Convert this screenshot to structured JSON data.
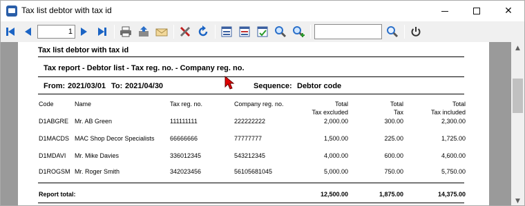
{
  "window": {
    "title": "Tax list debtor with tax id"
  },
  "toolbar": {
    "page_number": "1",
    "search_value": "",
    "icons": [
      "first-page-icon",
      "prev-page-icon",
      "next-page-icon",
      "last-page-icon",
      "print-icon",
      "export-icon",
      "email-icon",
      "tools-icon",
      "refresh-icon",
      "layout-icon",
      "layout2-icon",
      "layout-check-icon",
      "zoom-icon",
      "zoom-in-icon",
      "search-icon",
      "power-icon"
    ]
  },
  "report": {
    "title": "Tax list debtor with tax id",
    "subtitle": "Tax  report - Debtor list - Tax reg. no. - Company reg. no.",
    "from_label": "From:",
    "from_date": "2021/03/01",
    "to_label": "To:",
    "to_date": "2021/04/30",
    "sequence_label": "Sequence:",
    "sequence_value": "Debtor code",
    "columns": {
      "code": "Code",
      "name": "Name",
      "tax_reg": "Tax reg. no.",
      "company_reg": "Company reg. no.",
      "tax_excl_1": "Total",
      "tax_excl_2": "Tax excluded",
      "tax_1": "Total",
      "tax_2": "Tax",
      "tax_incl_1": "Total",
      "tax_incl_2": "Tax included"
    },
    "rows": [
      {
        "code": "D1ABGRE",
        "name": "Mr. AB Green",
        "tax_reg": "111111111",
        "company_reg": "222222222",
        "excl": "2,000.00",
        "tax": "300.00",
        "incl": "2,300.00"
      },
      {
        "code": "D1MACDS",
        "name": "MAC Shop Decor Specialists",
        "tax_reg": "66666666",
        "company_reg": "77777777",
        "excl": "1,500.00",
        "tax": "225.00",
        "incl": "1,725.00"
      },
      {
        "code": "D1MDAVI",
        "name": "Mr. Mike Davies",
        "tax_reg": "336012345",
        "company_reg": "543212345",
        "excl": "4,000.00",
        "tax": "600.00",
        "incl": "4,600.00"
      },
      {
        "code": "D1ROGSM",
        "name": "Mr. Roger Smith",
        "tax_reg": "342023456",
        "company_reg": "56105681045",
        "excl": "5,000.00",
        "tax": "750.00",
        "incl": "5,750.00"
      }
    ],
    "total_label": "Report total:",
    "total_excl": "12,500.00",
    "total_tax": "1,875.00",
    "total_incl": "14,375.00"
  }
}
